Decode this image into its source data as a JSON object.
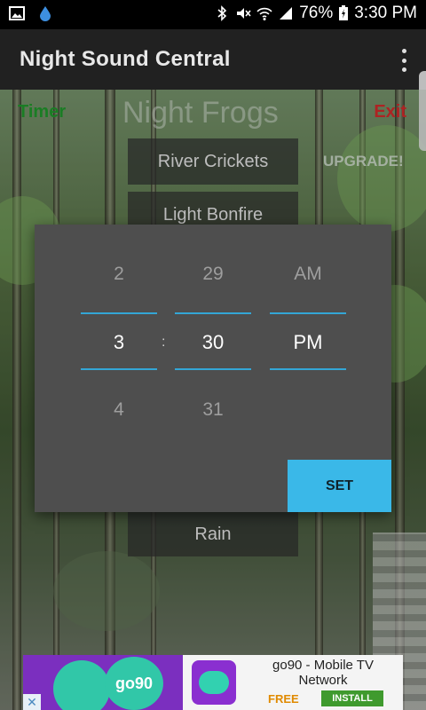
{
  "status_bar": {
    "battery": "76%",
    "time": "3:30 PM"
  },
  "app_bar": {
    "title": "Night Sound Central"
  },
  "main": {
    "timer_label": "Timer",
    "exit_label": "Exit",
    "upgrade_label": "UPGRADE!",
    "current_sound": "Night Frogs",
    "sounds": [
      "River Crickets",
      "Light Bonfire",
      "Rain"
    ]
  },
  "time_picker": {
    "hour": {
      "prev": "2",
      "current": "3",
      "next": "4"
    },
    "separator": ":",
    "minute": {
      "prev": "29",
      "current": "30",
      "next": "31"
    },
    "ampm": {
      "prev": "AM",
      "current": "PM"
    },
    "set_label": "SET",
    "accent_color": "#33a6d6",
    "set_color": "#3ab8e8"
  },
  "ad": {
    "brand": "go90",
    "title": "go90 - Mobile TV Network",
    "free_label": "FREE",
    "install_label": "INSTALL"
  }
}
